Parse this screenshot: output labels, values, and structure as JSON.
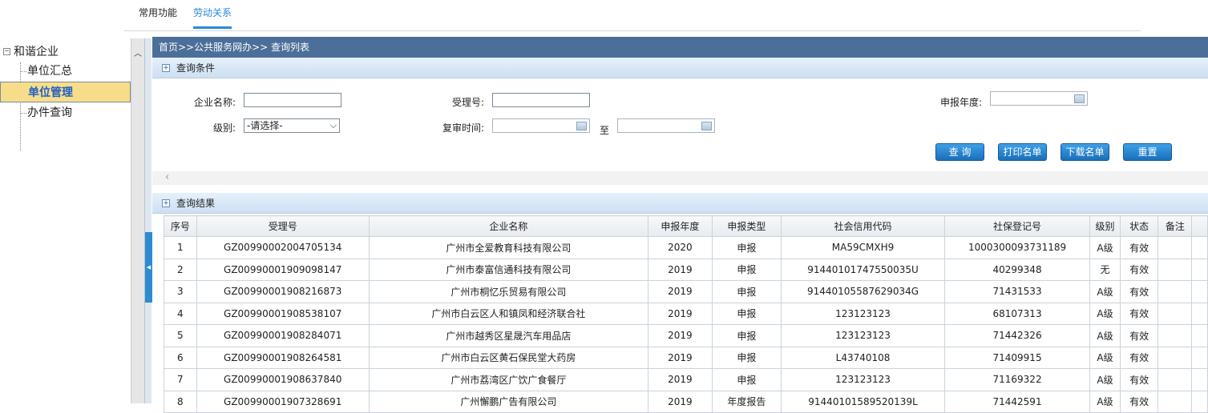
{
  "topnav": {
    "tabs": [
      "常用功能",
      "劳动关系"
    ]
  },
  "tree": {
    "root": "和谐企业",
    "items": [
      "单位汇总",
      "单位管理",
      "办件查询"
    ],
    "selected": "单位管理"
  },
  "breadcrumb": "首页>>公共服务网办>> 查询列表",
  "query": {
    "title": "查询条件",
    "labels": {
      "company": "企业名称:",
      "accept_no": "受理号:",
      "year": "申报年度:",
      "level": "级别:",
      "review_time": "复审时间:",
      "to": "至"
    },
    "level_value": "-请选择-",
    "buttons": {
      "query": "查 询",
      "print": "打印名单",
      "download": "下载名单",
      "reset": "重置"
    }
  },
  "results": {
    "title": "查询结果",
    "headers": [
      "序号",
      "受理号",
      "企业名称",
      "申报年度",
      "申报类型",
      "社会信用代码",
      "社保登记号",
      "级别",
      "状态",
      "备注"
    ],
    "rows": [
      [
        "1",
        "GZ00990002004705134",
        "广州市全爱教育科技有限公司",
        "2020",
        "申报",
        "MA59CMXH9",
        "1000300093731189",
        "A级",
        "有效",
        ""
      ],
      [
        "2",
        "GZ00990001909098147",
        "广州市泰富信通科技有限公司",
        "2019",
        "申报",
        "91440101747550035U",
        "40299348",
        "无",
        "有效",
        ""
      ],
      [
        "3",
        "GZ00990001908216873",
        "广州市桐忆乐贸易有限公司",
        "2019",
        "申报",
        "91440105587629034G",
        "71431533",
        "A级",
        "有效",
        ""
      ],
      [
        "4",
        "GZ00990001908538107",
        "广州市白云区人和镇凤和经济联合社",
        "2019",
        "申报",
        "123123123",
        "68107313",
        "A级",
        "有效",
        ""
      ],
      [
        "5",
        "GZ00990001908284071",
        "广州市越秀区星晟汽车用品店",
        "2019",
        "申报",
        "123123123",
        "71442326",
        "A级",
        "有效",
        ""
      ],
      [
        "6",
        "GZ00990001908264581",
        "广州市白云区黄石保民堂大药房",
        "2019",
        "申报",
        "L43740108",
        "71409915",
        "A级",
        "有效",
        ""
      ],
      [
        "7",
        "GZ00990001908637840",
        "广州市荔湾区广饮广食餐厅",
        "2019",
        "申报",
        "123123123",
        "71169322",
        "A级",
        "有效",
        ""
      ],
      [
        "8",
        "GZ00990001907328691",
        "广州懈鹏广告有限公司",
        "2019",
        "年度报告",
        "91440101589520139L",
        "71442591",
        "A级",
        "有效",
        ""
      ]
    ]
  }
}
